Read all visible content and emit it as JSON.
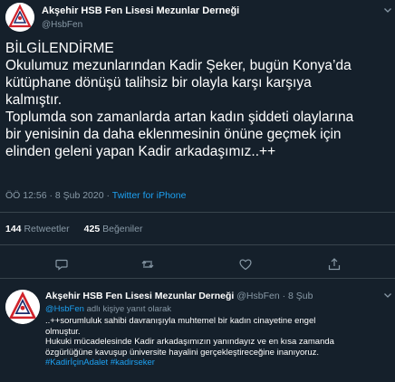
{
  "tweet": {
    "display_name": "Akşehir HSB Fen Lisesi Mezunlar Derneği",
    "handle": "@HsbFen",
    "lines": [
      "BİLGİLENDİRME",
      "Okulumuz mezunlarından Kadir Şeker, bugün Konya’da",
      "kütüphane dönüşü talihsiz bir olayla karşı karşıya",
      "kalmıştır.",
      "Toplumda son zamanlarda artan kadın şiddeti olaylarına",
      "bir yenisinin da daha eklenmesinin önüne geçmek için",
      "elinden geleni yapan Kadir arkadaşımız..++"
    ],
    "time": "ÖÖ 12:56 · 8 Şub 2020 ·",
    "source": "Twitter for iPhone",
    "retweets_count": "144",
    "retweets_label": "Retweetler",
    "likes_count": "425",
    "likes_label": "Beğeniler"
  },
  "reply": {
    "display_name": "Akşehir HSB Fen Lisesi Mezunlar Derneği",
    "handle_date": "@HsbFen · 8 Şub",
    "replying_to_handle": "@HsbFen",
    "replying_suffix": "adlı kişiye yanıt olarak",
    "lines": [
      "..++sorumluluk sahibi davranışıyla muhtemel bir kadın cinayetine engel",
      "olmuştur.",
      "Hukuki mücadelesinde Kadir arkadaşımızın yanındayız ve en kısa zamanda",
      "özgürlüğüne kavuşup üniversite hayalini gerçekleştireceğine inanıyoruz."
    ],
    "hashtags": "#KadirİçinAdalet #kadirseker"
  },
  "icons": {
    "avatar": "school-logo-icon",
    "menu": "chevron-down-icon",
    "reply": "reply-icon",
    "retweet": "retweet-icon",
    "like": "heart-icon",
    "share": "share-icon"
  },
  "colors": {
    "background": "#15202b",
    "text": "#ffffff",
    "muted": "#8899a6",
    "link": "#1da1f2",
    "divider": "#38444d",
    "logo_red": "#d0232b"
  }
}
